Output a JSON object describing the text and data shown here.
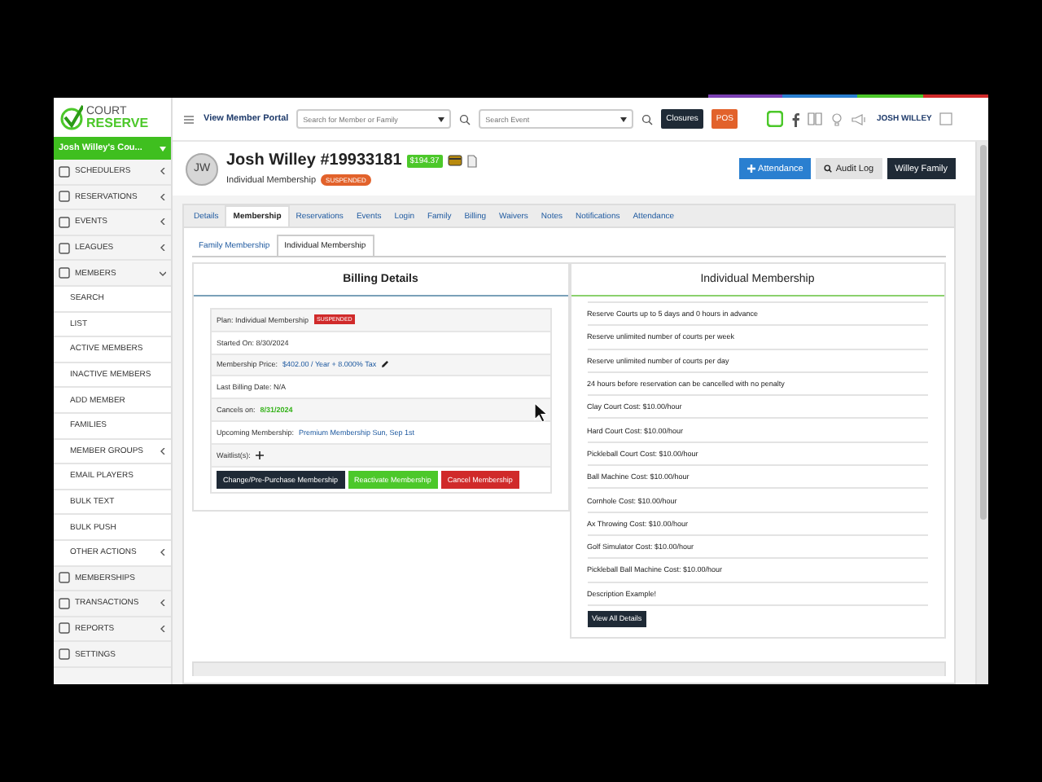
{
  "logo": {
    "line1": "COURT",
    "line2": "RESERVE"
  },
  "account": {
    "label": "Josh Willey's Cou..."
  },
  "sidebar": {
    "items": [
      {
        "label": "SCHEDULERS",
        "kind": "section",
        "expanded": false
      },
      {
        "label": "RESERVATIONS",
        "kind": "section",
        "expanded": false
      },
      {
        "label": "EVENTS",
        "kind": "section",
        "expanded": false
      },
      {
        "label": "LEAGUES",
        "kind": "section",
        "expanded": false
      },
      {
        "label": "MEMBERS",
        "kind": "section",
        "expanded": true
      },
      {
        "label": "SEARCH",
        "kind": "sub"
      },
      {
        "label": "LIST",
        "kind": "sub"
      },
      {
        "label": "ACTIVE MEMBERS",
        "kind": "sub"
      },
      {
        "label": "INACTIVE MEMBERS",
        "kind": "sub"
      },
      {
        "label": "ADD MEMBER",
        "kind": "sub"
      },
      {
        "label": "FAMILIES",
        "kind": "sub"
      },
      {
        "label": "MEMBER GROUPS",
        "kind": "sub",
        "expanded": false
      },
      {
        "label": "EMAIL PLAYERS",
        "kind": "sub"
      },
      {
        "label": "BULK TEXT",
        "kind": "sub"
      },
      {
        "label": "BULK PUSH",
        "kind": "sub"
      },
      {
        "label": "OTHER ACTIONS",
        "kind": "sub",
        "expanded": false
      },
      {
        "label": "MEMBERSHIPS",
        "kind": "section"
      },
      {
        "label": "TRANSACTIONS",
        "kind": "section",
        "expanded": false
      },
      {
        "label": "REPORTS",
        "kind": "section",
        "expanded": false
      },
      {
        "label": "SETTINGS",
        "kind": "section"
      }
    ]
  },
  "topbar": {
    "portal_link": "View Member Portal",
    "member_search": {
      "placeholder": "Search for Member or Family"
    },
    "event_search": {
      "placeholder": "Search Event"
    },
    "buttons": [
      {
        "label": "Closures",
        "kind": "dark"
      },
      {
        "label": "POS",
        "kind": "orange"
      }
    ],
    "user": "JOSH WILLEY"
  },
  "member": {
    "initials": "JW",
    "name": "Josh Willey #19933181",
    "balance": "$194.37",
    "membership": "Individual Membership",
    "status": "SUSPENDED"
  },
  "actions": [
    {
      "label": "Attendance",
      "kind": "primary"
    },
    {
      "label": "Audit Log",
      "kind": "light"
    },
    {
      "label": "Willey Family",
      "kind": "dark"
    }
  ],
  "tabs": [
    {
      "label": "Details",
      "selected": false
    },
    {
      "label": "Membership",
      "selected": true
    },
    {
      "label": "Reservations",
      "selected": false
    },
    {
      "label": "Events",
      "selected": false
    },
    {
      "label": "Login",
      "selected": false
    },
    {
      "label": "Family",
      "selected": false
    },
    {
      "label": "Billing",
      "selected": false
    },
    {
      "label": "Waivers",
      "selected": false
    },
    {
      "label": "Notes",
      "selected": false
    },
    {
      "label": "Notifications",
      "selected": false
    },
    {
      "label": "Attendance",
      "selected": false
    }
  ],
  "subtabs": [
    {
      "label": "Family Membership",
      "selected": false
    },
    {
      "label": "Individual Membership",
      "selected": true
    }
  ],
  "billing": {
    "title": "Billing Details",
    "rows": [
      {
        "kind": "badge",
        "label": "Plan: Individual Membership",
        "value": "SUSPENDED"
      },
      {
        "kind": "plain",
        "label": "Started On: 8/30/2024"
      },
      {
        "kind": "edit",
        "label": "Membership Price:",
        "value": "$402.00 / Year + 8.000% Tax"
      },
      {
        "kind": "plain",
        "label": "Last Billing Date: N/A"
      },
      {
        "kind": "date",
        "label": "Cancels on:",
        "value": "8/31/2024"
      },
      {
        "kind": "link",
        "label": "Upcoming Membership:",
        "value": "Premium Membership Sun, Sep 1st"
      },
      {
        "kind": "add",
        "label": "Waitlist(s):"
      }
    ],
    "buttons": [
      {
        "label": "Change/Pre-Purchase Membership",
        "kind": "dark"
      },
      {
        "label": "Reactivate Membership",
        "kind": "success"
      },
      {
        "label": "Cancel Membership",
        "kind": "danger"
      }
    ]
  },
  "plan": {
    "title": "Individual Membership",
    "features": [
      "Reserve Courts up to 5 days and 0 hours in advance",
      "Reserve unlimited number of courts per week",
      "Reserve unlimited number of courts per day",
      "24 hours before reservation can be cancelled with no penalty",
      "Clay Court Cost: $10.00/hour",
      "Hard Court Cost: $10.00/hour",
      "Pickleball Court Cost: $10.00/hour",
      "Ball Machine Cost: $10.00/hour",
      "Cornhole Cost: $10.00/hour",
      "Ax Throwing Cost: $10.00/hour",
      "Golf Simulator Cost: $10.00/hour",
      "Pickleball Ball Machine Cost: $10.00/hour",
      "Description Example!"
    ],
    "button": "View All Details"
  }
}
